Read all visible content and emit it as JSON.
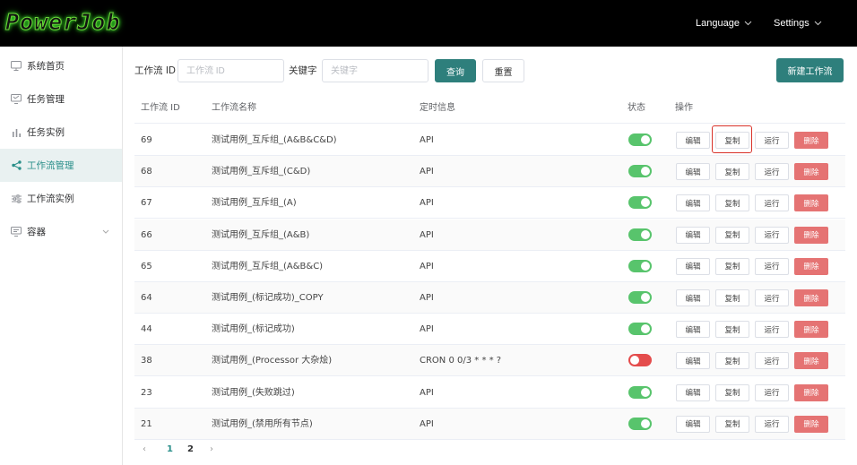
{
  "header": {
    "logo_text": "PowerJob",
    "language_label": "Language",
    "settings_label": "Settings"
  },
  "sidebar": {
    "items": [
      {
        "label": "系统首页",
        "icon": "monitor-icon"
      },
      {
        "label": "任务管理",
        "icon": "task-icon"
      },
      {
        "label": "任务实例",
        "icon": "bar-chart-icon"
      },
      {
        "label": "工作流管理",
        "icon": "share-icon",
        "active": true
      },
      {
        "label": "工作流实例",
        "icon": "sliders-icon"
      },
      {
        "label": "容器",
        "icon": "container-icon"
      }
    ]
  },
  "filters": {
    "id_label": "工作流 ID",
    "id_placeholder": "工作流 ID",
    "keyword_label": "关键字",
    "keyword_placeholder": "关键字",
    "query_button": "查询",
    "reset_button": "重置",
    "new_button": "新建工作流"
  },
  "table": {
    "headers": {
      "id": "工作流 ID",
      "name": "工作流名称",
      "schedule": "定时信息",
      "status": "状态",
      "actions": "操作"
    },
    "action_labels": {
      "edit": "编辑",
      "copy": "复制",
      "run": "运行",
      "delete": "删除"
    },
    "rows": [
      {
        "id": "69",
        "name": "测试用例_互斥组_(A&B&C&D)",
        "schedule": "API",
        "enabled": true
      },
      {
        "id": "68",
        "name": "测试用例_互斥组_(C&D)",
        "schedule": "API",
        "enabled": true
      },
      {
        "id": "67",
        "name": "测试用例_互斥组_(A)",
        "schedule": "API",
        "enabled": true
      },
      {
        "id": "66",
        "name": "测试用例_互斥组_(A&B)",
        "schedule": "API",
        "enabled": true
      },
      {
        "id": "65",
        "name": "测试用例_互斥组_(A&B&C)",
        "schedule": "API",
        "enabled": true
      },
      {
        "id": "64",
        "name": "测试用例_(标记成功)_COPY",
        "schedule": "API",
        "enabled": true
      },
      {
        "id": "44",
        "name": "测试用例_(标记成功)",
        "schedule": "API",
        "enabled": true
      },
      {
        "id": "38",
        "name": "测试用例_(Processor 大杂烩)",
        "schedule": "CRON 0 0/3 * * * ?",
        "enabled": false
      },
      {
        "id": "23",
        "name": "测试用例_(失败跳过)",
        "schedule": "API",
        "enabled": true
      },
      {
        "id": "21",
        "name": "测试用例_(禁用所有节点)",
        "schedule": "API",
        "enabled": true
      }
    ]
  },
  "pagination": {
    "prev": "‹",
    "pages": [
      "1",
      "2"
    ],
    "current": "1",
    "next": "›"
  },
  "colors": {
    "accent": "#2e7f7c",
    "danger": "#e57373",
    "switch_on": "#58c46c",
    "switch_off": "#e44c4c",
    "highlight": "#d9332a"
  }
}
